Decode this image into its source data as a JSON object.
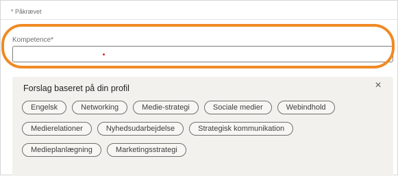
{
  "form": {
    "required_note": "* Påkrævet",
    "field_label": "Kompetence*",
    "field_value": "",
    "field_placeholder": ""
  },
  "suggestions": {
    "title": "Forslag baseret på din profil",
    "close_glyph": "×",
    "rows": [
      [
        "Engelsk",
        "Networking",
        "Medie-strategi",
        "Sociale medier",
        "Webindhold"
      ],
      [
        "Medierelationer",
        "Nyhedsudarbejdelse",
        "Strategisk kommunikation"
      ],
      [
        "Medieplanlægning",
        "Marketingsstrategi"
      ]
    ]
  },
  "colors": {
    "highlight": "#f08a24",
    "panel_bg": "#f3f1ed",
    "cursor_dot": "#e0233a"
  },
  "icons": {
    "close": "close-icon"
  }
}
